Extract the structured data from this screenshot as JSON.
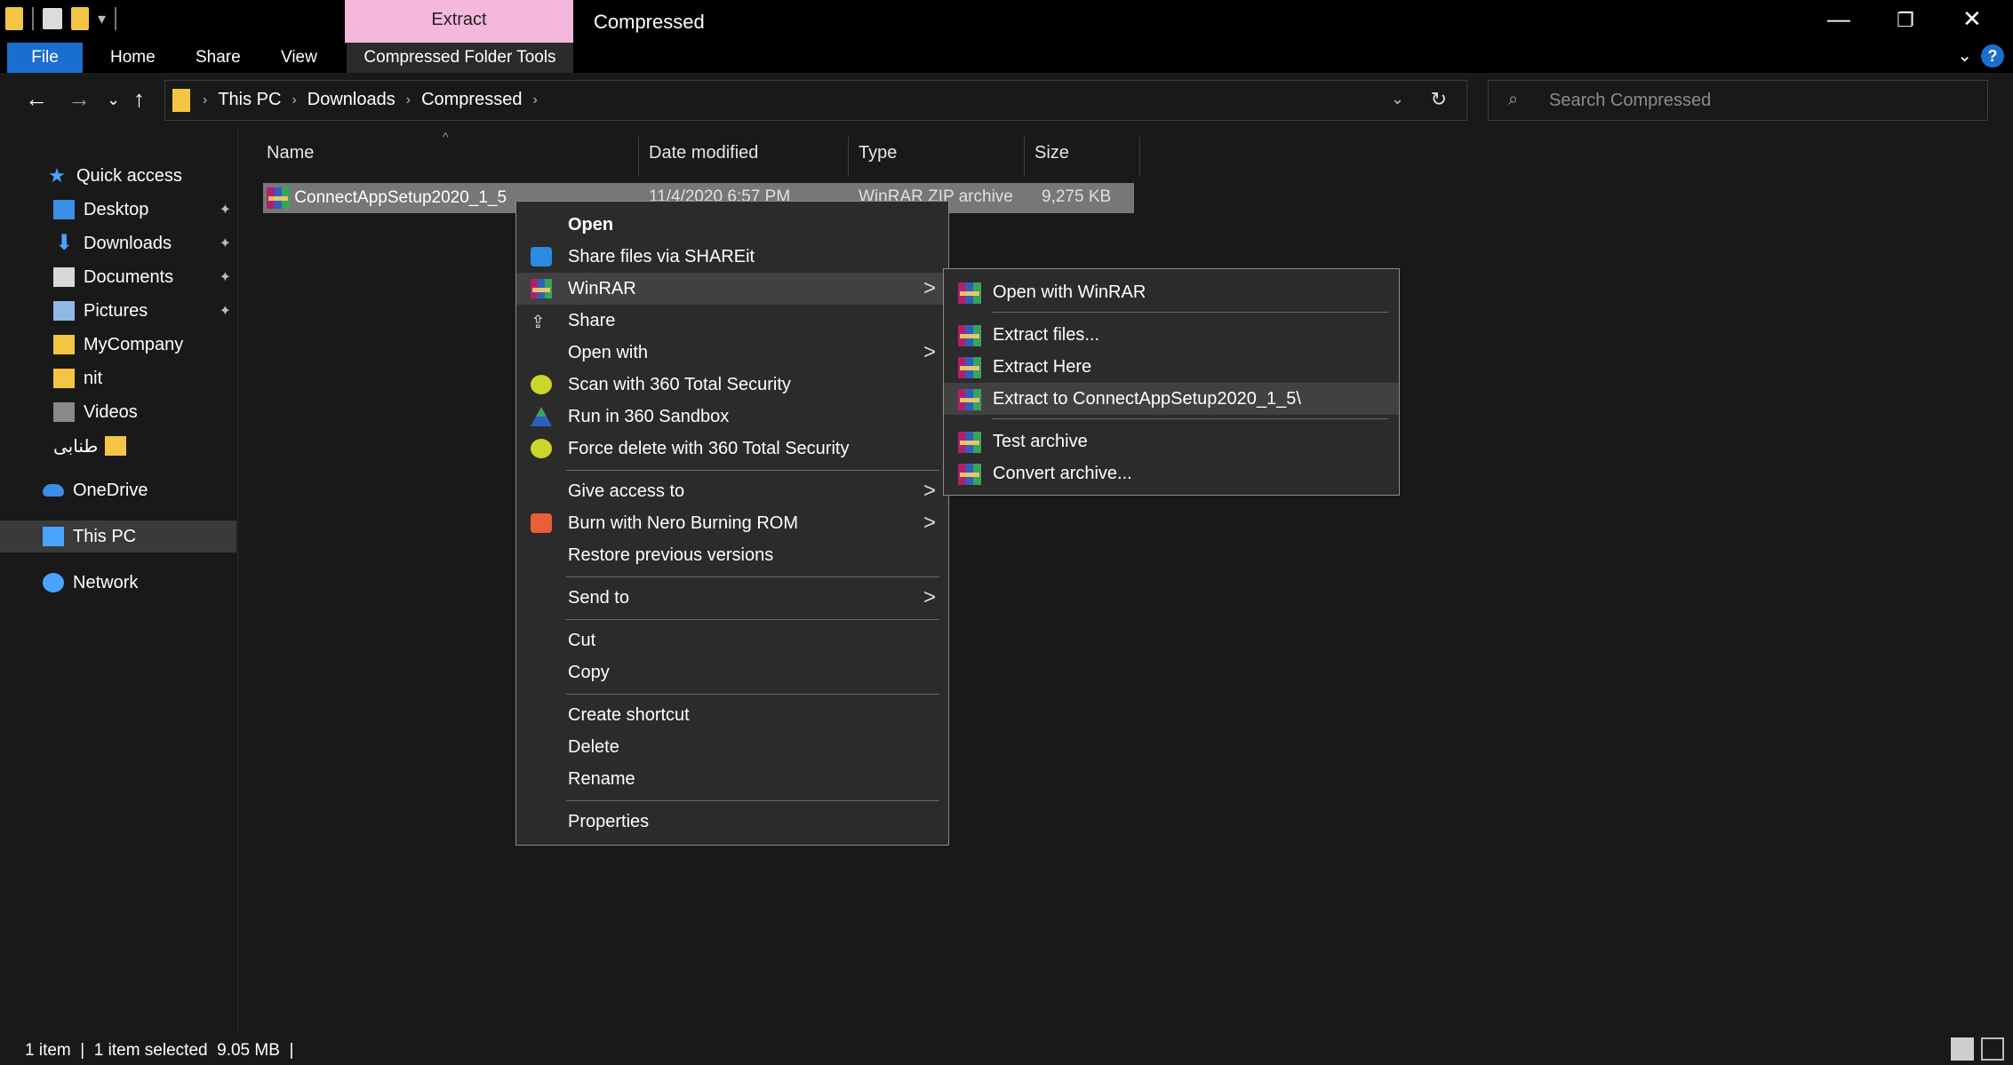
{
  "titlebar": {
    "contextual_tab_header": "Extract",
    "window_title": "Compressed",
    "minimize": "—",
    "restore": "❐",
    "close": "✕"
  },
  "ribbon": {
    "tabs": [
      "File",
      "Home",
      "Share",
      "View",
      "Compressed Folder Tools"
    ],
    "help": "?",
    "collapse": "⌄"
  },
  "navigation": {
    "back": "←",
    "forward": "→",
    "recent": "⌄",
    "up": "↑"
  },
  "address": {
    "crumbs": [
      "This PC",
      "Downloads",
      "Compressed"
    ],
    "separator": "›",
    "dropdown": "⌄",
    "refresh": "↻"
  },
  "search": {
    "icon": "⌕",
    "placeholder": "Search Compressed"
  },
  "navpane": {
    "items": [
      {
        "label": "Quick access",
        "icon": "star-icon"
      },
      {
        "label": "Desktop",
        "icon": "desktop-icon",
        "pinned": true
      },
      {
        "label": "Downloads",
        "icon": "download-icon",
        "pinned": true
      },
      {
        "label": "Documents",
        "icon": "document-icon",
        "pinned": true
      },
      {
        "label": "Pictures",
        "icon": "pictures-icon",
        "pinned": true
      },
      {
        "label": "MyCompany",
        "icon": "folder-icon"
      },
      {
        "label": "nit",
        "icon": "folder-icon"
      },
      {
        "label": "Videos",
        "icon": "videos-icon"
      },
      {
        "label": "طنابی",
        "icon": "folder-icon"
      },
      {
        "label": "OneDrive",
        "icon": "cloud-icon"
      },
      {
        "label": "This PC",
        "icon": "computer-icon",
        "selected": true
      },
      {
        "label": "Network",
        "icon": "network-icon"
      }
    ],
    "pin_glyph": "📌"
  },
  "filelist": {
    "columns": [
      "Name",
      "Date modified",
      "Type",
      "Size"
    ],
    "sort_caret": "^",
    "rows": [
      {
        "name": "ConnectAppSetup2020_1_5",
        "date": "11/4/2020 6:57 PM",
        "type": "WinRAR ZIP archive",
        "size": "9,275 KB",
        "selected": true
      }
    ]
  },
  "context_menu": {
    "items": [
      "Open",
      "Share files via SHAREit",
      "WinRAR",
      "Share",
      "Open with",
      "Scan with 360 Total Security",
      "Run in 360 Sandbox",
      "Force delete with 360 Total Security",
      "Give access to",
      "Burn with Nero Burning ROM",
      "Restore previous versions",
      "Send to",
      "Cut",
      "Copy",
      "Create shortcut",
      "Delete",
      "Rename",
      "Properties"
    ],
    "arrow": ">"
  },
  "winrar_submenu": {
    "items": [
      "Open with WinRAR",
      "Extract files...",
      "Extract Here",
      "Extract to ConnectAppSetup2020_1_5\\",
      "Test archive",
      "Convert archive..."
    ]
  },
  "statusbar": {
    "text": "1 item  |  1 item selected  9.05 MB  |"
  },
  "colors": {
    "accent": "#1a6ecf",
    "contextual_tab": "#f4b8dc",
    "background": "#191919",
    "menu_bg": "#2b2b2b",
    "selection": "#777777"
  }
}
